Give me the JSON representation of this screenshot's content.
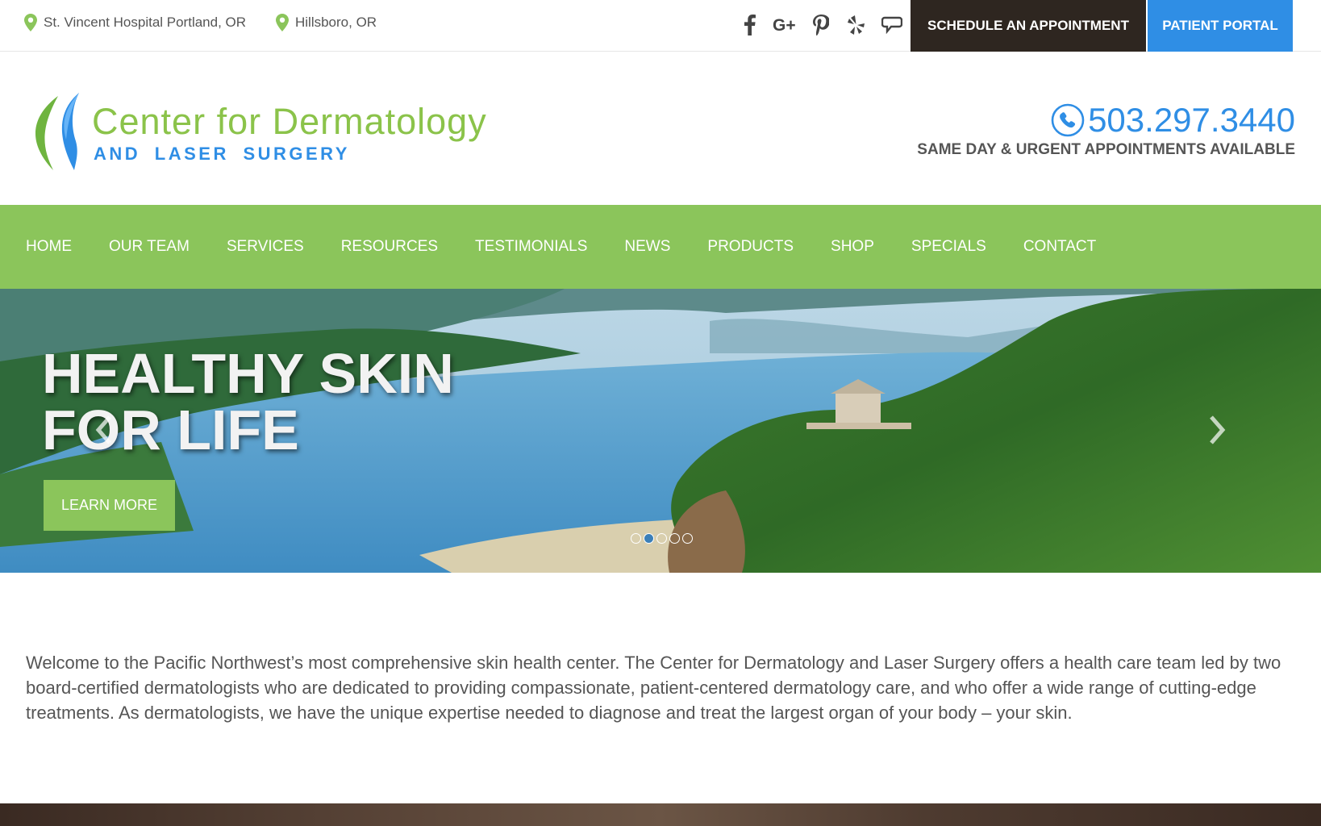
{
  "topbar": {
    "locations": [
      {
        "label": "St. Vincent Hospital Portland, OR",
        "icon": "map-pin-icon"
      },
      {
        "label": "Hillsboro, OR",
        "icon": "map-pin-icon"
      }
    ],
    "social_icons": [
      "facebook-icon",
      "google-plus-icon",
      "pinterest-icon",
      "yelp-icon",
      "review-bubble-icon"
    ],
    "schedule_label": "SCHEDULE AN APPOINTMENT",
    "portal_label": "PATIENT PORTAL"
  },
  "header": {
    "logo_line1": "Center for Dermatology",
    "logo_line2": "AND LASER SURGERY",
    "phone": "503.297.3440",
    "phone_subtitle": "SAME DAY & URGENT APPOINTMENTS AVAILABLE"
  },
  "nav": {
    "items": [
      "HOME",
      "OUR TEAM",
      "SERVICES",
      "RESOURCES",
      "TESTIMONIALS",
      "NEWS",
      "PRODUCTS",
      "SHOP",
      "SPECIALS",
      "CONTACT"
    ]
  },
  "hero": {
    "title_line1": "HEALTHY SKIN",
    "title_line2": "FOR LIFE",
    "button_label": "LEARN MORE",
    "slide_count": 5,
    "active_slide": 2
  },
  "welcome": {
    "text": "Welcome to the Pacific Northwest’s most comprehensive skin health center. The Center for Dermatology and Laser Surgery offers a health care team led by two board-certified dermatologists who are dedicated to providing compassionate, patient-centered dermatology care, and who offer a wide range of cutting-edge treatments. As dermatologists, we have the unique expertise needed to diagnose and treat the largest organ of your body – your skin."
  },
  "colors": {
    "green": "#8bc55b",
    "blue": "#2f8ee5",
    "dark": "#2e2620"
  }
}
